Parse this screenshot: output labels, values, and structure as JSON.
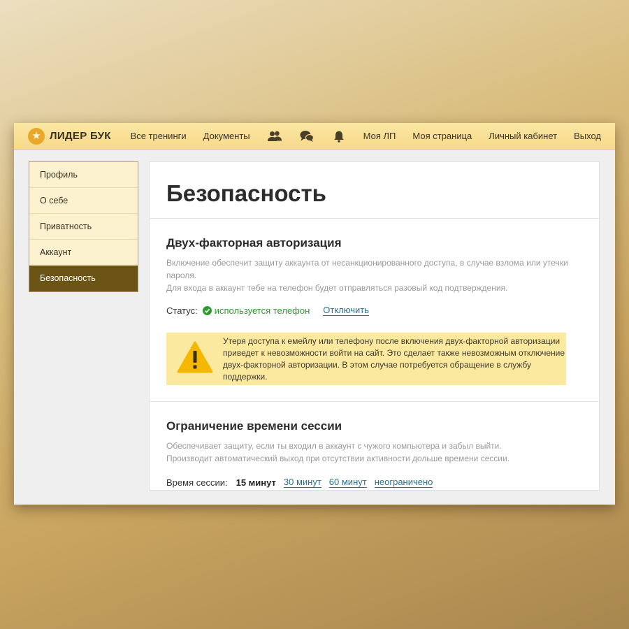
{
  "header": {
    "logo_text": "ЛИДЕР БУК",
    "nav": {
      "all_trainings": "Все тренинги",
      "documents": "Документы",
      "my_lp": "Моя ЛП",
      "my_page": "Моя страница",
      "cabinet": "Личный кабинет",
      "logout": "Выход"
    },
    "icons": [
      "users-icon",
      "chat-icon",
      "bell-icon"
    ]
  },
  "sidebar": {
    "items": [
      {
        "label": "Профиль"
      },
      {
        "label": "О себе"
      },
      {
        "label": "Приватность"
      },
      {
        "label": "Аккаунт"
      },
      {
        "label": "Безопасность",
        "active": true
      }
    ]
  },
  "main": {
    "title": "Безопасность",
    "two_factor": {
      "title": "Двух-факторная авторизация",
      "desc_line1": "Включение обеспечит защиту аккаунта от несанкционированного доступа, в случае взлома или утечки пароля.",
      "desc_line2": "Для входа в аккаунт тебе на телефон будет отправляться разовый код подтверждения.",
      "status_label": "Статус:",
      "status_value": "используется телефон",
      "disable_link": "Отключить",
      "warning_line1": "Утеря доступа к емейлу или телефону после включения двух-факторной авторизации",
      "warning_line2": "приведет к невозможности войти на сайт. Это сделает также невозможным отключение",
      "warning_line3": "двух-факторной авторизации. В этом случае потребуется обращение в службу поддержки."
    },
    "session": {
      "title": "Ограничение времени сессии",
      "desc_line1": "Обеспечивает защиту, если ты входил в аккаунт с чужого компьютера и забыл выйти.",
      "desc_line2": "Производит автоматический выход при отсутствии активности дольше времени сессии.",
      "label": "Время сессии:",
      "current": "15 минут",
      "options": [
        "30 минут",
        "60 минут",
        "неограничено"
      ]
    }
  },
  "colors": {
    "accent_dark": "#6b5416",
    "topbar": "#f7d98a",
    "link": "#2b6f8f",
    "status_ok": "#2f9a2f",
    "warning_bg": "#fbe9a0"
  }
}
